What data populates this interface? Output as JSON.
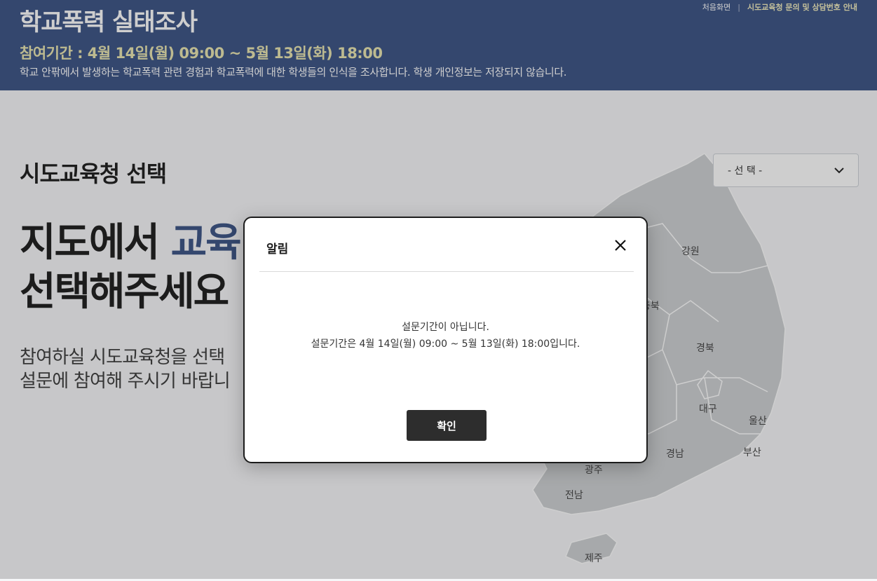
{
  "header": {
    "title": "학교폭력 실태조사",
    "period": "참여기간 : 4월 14일(월) 09:00 ~ 5월 13일(화) 18:00",
    "description": "학교 안팎에서 발생하는 학교폭력 관련 경험과 학교폭력에 대한 학생들의 인식을 조사합니다. 학생 개인정보는 저장되지 않습니다.",
    "links": {
      "home": "처음화면",
      "contact": "시도교육청 문의 및 상담번호 안내"
    }
  },
  "main": {
    "section_title": "시도교육청 선택",
    "headline_line1_plain": "지도에서 ",
    "headline_line1_accent": "교육",
    "headline_line2": "선택해주세요",
    "subtext_line1": "참여하실 시도교육청을 선택",
    "subtext_line2": "설문에 참여해 주시기 바랍니"
  },
  "select": {
    "value": "- 선 택 -"
  },
  "map": {
    "regions": [
      "강원",
      "충북",
      "경북",
      "대구",
      "울산",
      "부산",
      "경남",
      "광주",
      "전남",
      "제주"
    ]
  },
  "modal": {
    "title": "알림",
    "message_line1": "설문기간이 아닙니다.",
    "message_line2": "설문기간은 4월 14일(월) 09:00 ~ 5월 13일(화) 18:00입니다.",
    "confirm_label": "확인"
  },
  "colors": {
    "header_bg": "#3a5285",
    "period_text": "#e9e6b0",
    "accent": "#3a5285",
    "confirm_bg": "#2d2d2d"
  }
}
